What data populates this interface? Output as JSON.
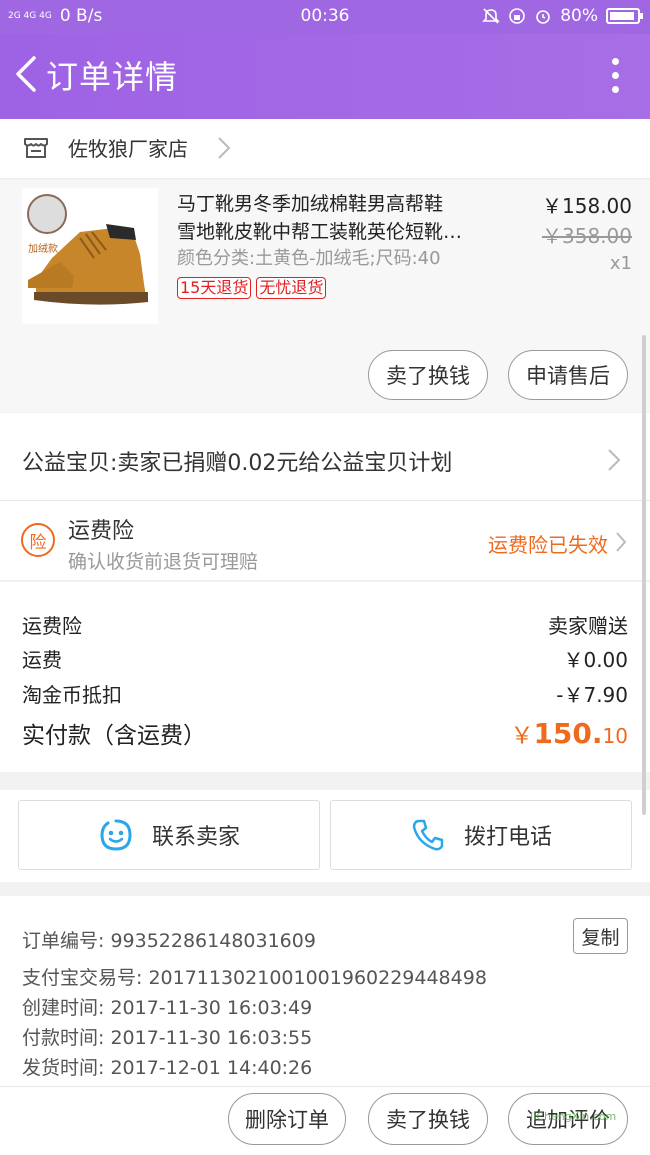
{
  "status_bar": {
    "signal": "2G 4G 4G",
    "speed": "0 B/s",
    "time": "00:36",
    "battery": "80%"
  },
  "nav": {
    "title": "订单详情"
  },
  "shop": {
    "name": "佐牧狼厂家店"
  },
  "product": {
    "title_line1": "马丁靴男冬季加绒棉鞋男高帮鞋",
    "title_line2": "雪地靴皮靴中帮工装靴英伦短靴…",
    "sku": "颜色分类:土黄色-加绒毛;尺码:40",
    "tags": [
      "15天退货",
      "无忧退货"
    ],
    "thumb_tag": "加绒款",
    "price": "￥158.00",
    "original_price": "￥358.00",
    "quantity": "x1",
    "actions": [
      "卖了换钱",
      "申请售后"
    ]
  },
  "charity": {
    "text": "公益宝贝:卖家已捐赠0.02元给公益宝贝计划"
  },
  "insurance": {
    "badge": "险",
    "title": "运费险",
    "subtitle": "确认收货前退货可理赔",
    "status": "运费险已失效"
  },
  "costs": {
    "rows": [
      {
        "label": "运费险",
        "value": "卖家赠送"
      },
      {
        "label": "运费",
        "value": "￥0.00"
      },
      {
        "label": "淘金币抵扣",
        "value": "-￥7.90"
      }
    ],
    "total_label": "实付款（含运费）",
    "total_symbol": "￥",
    "total_int": "150.",
    "total_dec": "10"
  },
  "contact": {
    "seller_label": "联系卖家",
    "phone_label": "拨打电话"
  },
  "order_info": {
    "order_no": "订单编号:  99352286148031609",
    "alipay_no": "支付宝交易号:  2017113021001001960229448498",
    "created": "创建时间:  2017-11-30 16:03:49",
    "paid": "付款时间:  2017-11-30 16:03:55",
    "shipped": "发货时间:  2017-12-01 14:40:26",
    "copy_label": "复制"
  },
  "bottom": {
    "delete_label": "删除订单",
    "sell_label": "卖了换钱",
    "review_label": "追加评价"
  },
  "watermark": "JiChengXin.com",
  "colors": {
    "header": "#a067e2",
    "accent_orange": "#f06a1e",
    "tag_red": "#e02020"
  }
}
